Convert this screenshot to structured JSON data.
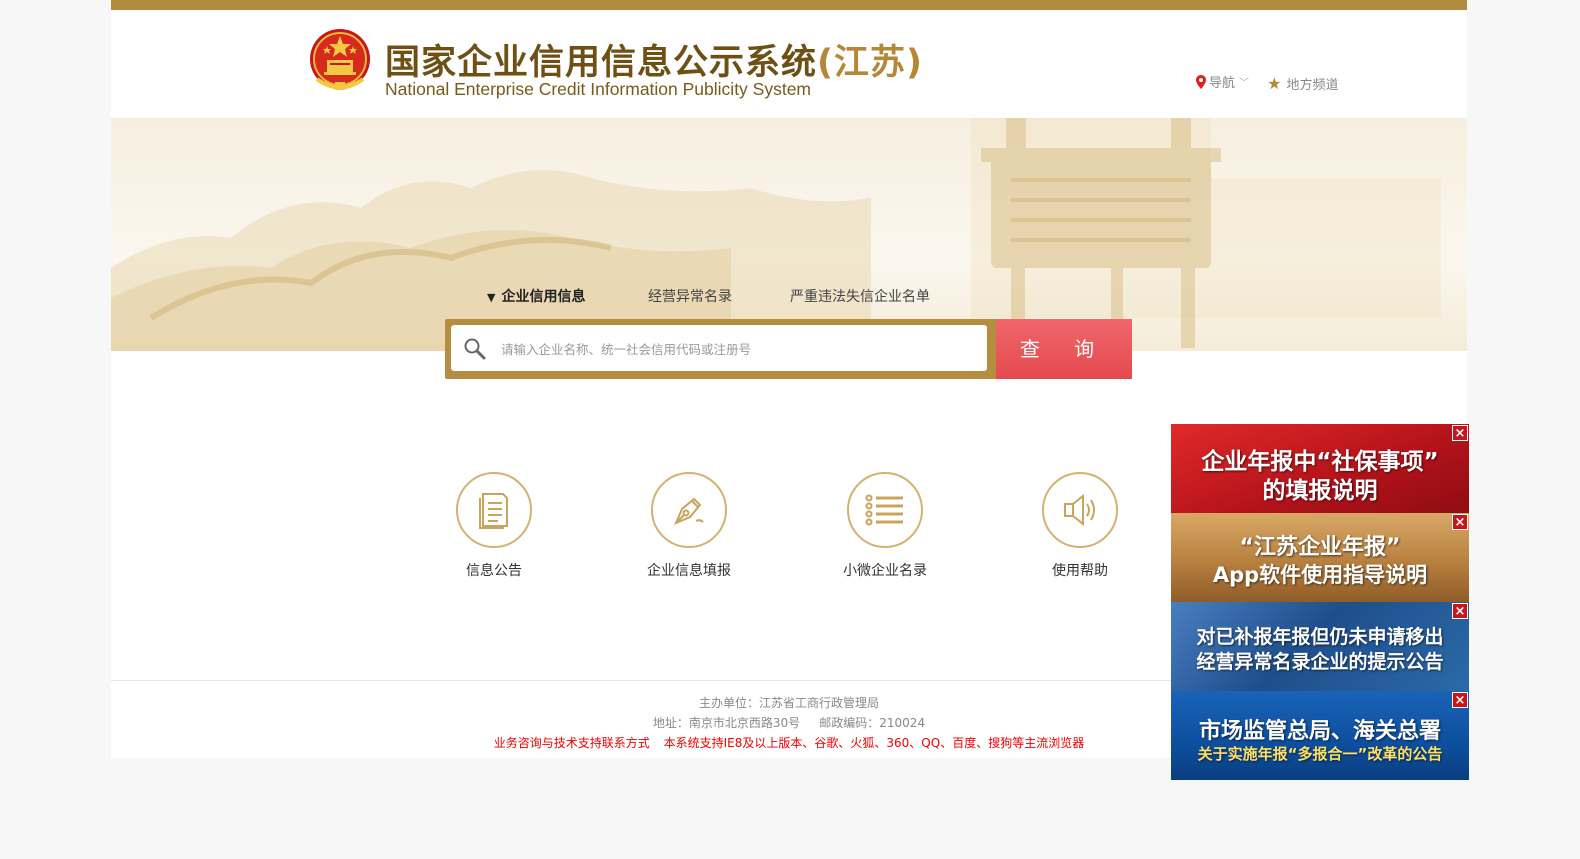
{
  "header": {
    "title_cn": "国家企业信用信息公示系统",
    "title_province": "(江苏)",
    "title_en": "National Enterprise Credit Information Publicity System",
    "nav_label": "导航",
    "local_channel_label": "地方频道"
  },
  "search": {
    "tabs": [
      {
        "label": "企业信用信息",
        "active": true
      },
      {
        "label": "经营异常名录",
        "active": false
      },
      {
        "label": "严重违法失信企业名单",
        "active": false
      }
    ],
    "placeholder": "请输入企业名称、统一社会信用代码或注册号",
    "button_label": "查 询"
  },
  "quick_links": [
    {
      "label": "信息公告",
      "icon": "document-icon"
    },
    {
      "label": "企业信息填报",
      "icon": "pen-icon"
    },
    {
      "label": "小微企业名录",
      "icon": "list-icon"
    },
    {
      "label": "使用帮助",
      "icon": "speaker-icon"
    }
  ],
  "footer": {
    "sponsor": "主办单位：江苏省工商行政管理局",
    "address": "地址：南京市北京西路30号",
    "postcode": "邮政编码：210024",
    "support_contact": "业务咨询与技术支持联系方式",
    "browser_note": "本系统支持IE8及以上版本、谷歌、火狐、360、QQ、百度、搜狗等主流浏览器"
  },
  "side_ads": [
    {
      "line1": "企业年报中“社保事项”",
      "line2": "的填报说明",
      "bg": "#c0151b"
    },
    {
      "line1": "“江苏企业年报”",
      "line2": "App软件使用指导说明",
      "bg": "#b57a3a"
    },
    {
      "line1": "对已补报年报但仍未申请移出",
      "line2": "经营异常名录企业的提示公告",
      "bg": "#1f4e8c"
    },
    {
      "line1": "市场监管总局、海关总署",
      "line2": "关于实施年报“多报合一”改革的公告",
      "bg": "#0d4f9e"
    }
  ],
  "colors": {
    "gold": "#b08a3e",
    "search_button": "#e44a4e",
    "circle_border": "#d3b26f"
  }
}
